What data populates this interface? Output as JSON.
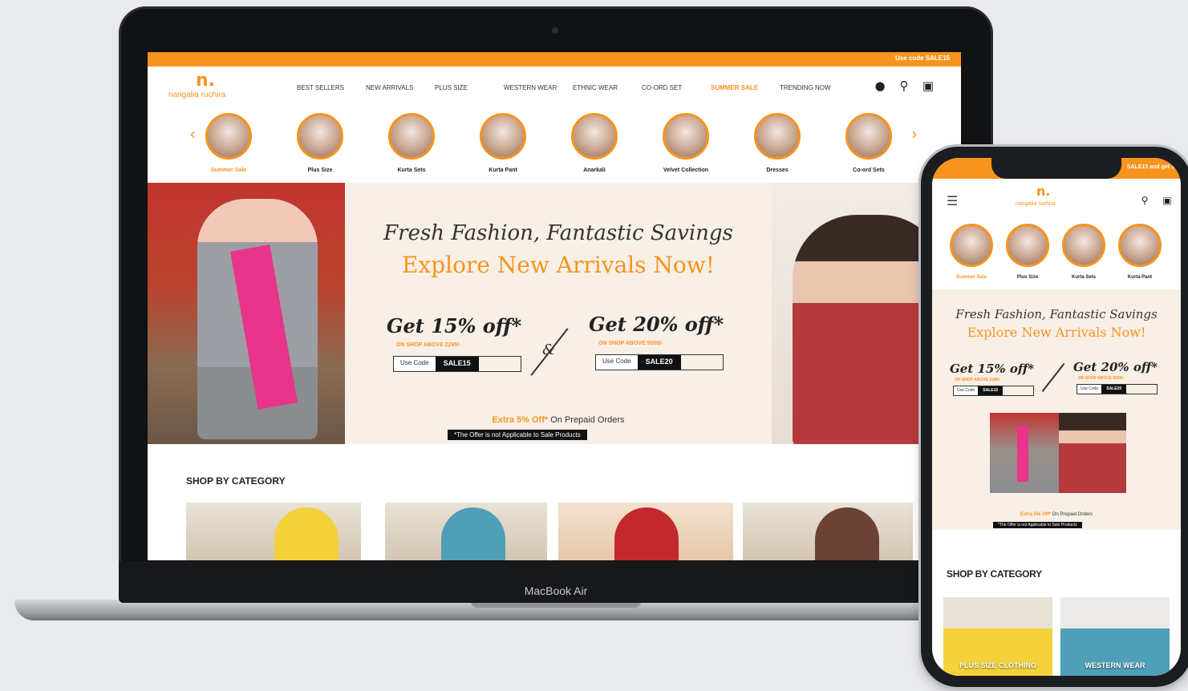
{
  "laptop": {
    "bezel_label": "MacBook Air",
    "announcement": "Use code SALE15",
    "brand": {
      "mark": "n.",
      "name": "nangalia ruchira"
    },
    "nav": [
      "Best Sellers",
      "New Arrivals",
      "Plus Size",
      "Western Wear",
      "Ethnic Wear",
      "Co-ord Set",
      "Summer Sale",
      "Trending Now"
    ],
    "nav_highlight_index": 6,
    "header_icons": [
      "user-icon",
      "search-icon",
      "bag-icon"
    ],
    "categories": [
      "Summer Sale",
      "Plus Size",
      "Kurta Sets",
      "Kurta Pant",
      "Anarkali",
      "Velvet Collection",
      "Dresses",
      "Co-ord Sets"
    ],
    "hero": {
      "script": "Fresh Fashion, Fantastic Savings",
      "headline": "Explore New Arrivals Now!",
      "offers": [
        {
          "title": "Get 15% off*",
          "sub": "ON SHOP ABOVE 2295/-",
          "code_label": "Use Code",
          "code": "SALE15"
        },
        {
          "title": "Get 20% off*",
          "sub": "ON SHOP ABOVE 5000/-",
          "code_label": "Use Code",
          "code": "SALE20"
        }
      ],
      "amp": "&",
      "extra_highlight": "Extra 5% Off*",
      "extra_rest": " On Prepaid Orders",
      "disclaimer": "*The Offer is not Applicable to Sale Products"
    },
    "shop_title": "SHOP BY CATEGORY"
  },
  "phone": {
    "announcement": "SALE15 and get 1",
    "brand": {
      "mark": "n.",
      "name": "nangalia ruchira"
    },
    "categories": [
      "Summer Sale",
      "Plus Size",
      "Kurta Sets",
      "Kurta Pant"
    ],
    "hero": {
      "script": "Fresh Fashion, Fantastic Savings",
      "headline": "Explore New Arrivals Now!",
      "offers": [
        {
          "title": "Get 15% off*",
          "sub": "ON SHOP ABOVE 2295/-",
          "code_label": "Use Code",
          "code": "SALE15"
        },
        {
          "title": "Get 20% off*",
          "sub": "ON SHOP ABOVE 5000/-",
          "code_label": "Use Code",
          "code": "SALE20"
        }
      ],
      "extra_highlight": "Extra 5% Off*",
      "extra_rest": " On Prepaid Orders",
      "disclaimer": "*The Offer is not Applicable to Sale Products"
    },
    "shop_title": "SHOP BY CATEGORY",
    "tiles": [
      "PLUS SIZE CLOTHING",
      "WESTERN WEAR"
    ]
  },
  "colors": {
    "accent": "#f7941d",
    "dark": "#111111",
    "hero_bg": "#f8efe7"
  }
}
